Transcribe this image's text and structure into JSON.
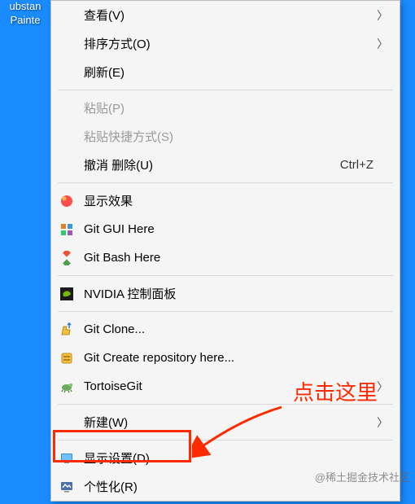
{
  "desktop": {
    "icon_label": "ubstan\nPainte"
  },
  "menu": {
    "view": "查看(V)",
    "sort": "排序方式(O)",
    "refresh": "刷新(E)",
    "paste": "粘贴(P)",
    "paste_shortcut": "粘贴快捷方式(S)",
    "undo_delete": "撤消 删除(U)",
    "undo_delete_key": "Ctrl+Z",
    "display_effect": "显示效果",
    "git_gui": "Git GUI Here",
    "git_bash": "Git Bash Here",
    "nvidia": "NVIDIA 控制面板",
    "git_clone": "Git Clone...",
    "git_create": "Git Create repository here...",
    "tortoise": "TortoiseGit",
    "new": "新建(W)",
    "display_settings": "显示设置(D)",
    "personalize": "个性化(R)"
  },
  "annotation": {
    "text": "点击这里",
    "watermark1": "@稀土掘金技术社区",
    "watermark2": "​"
  }
}
